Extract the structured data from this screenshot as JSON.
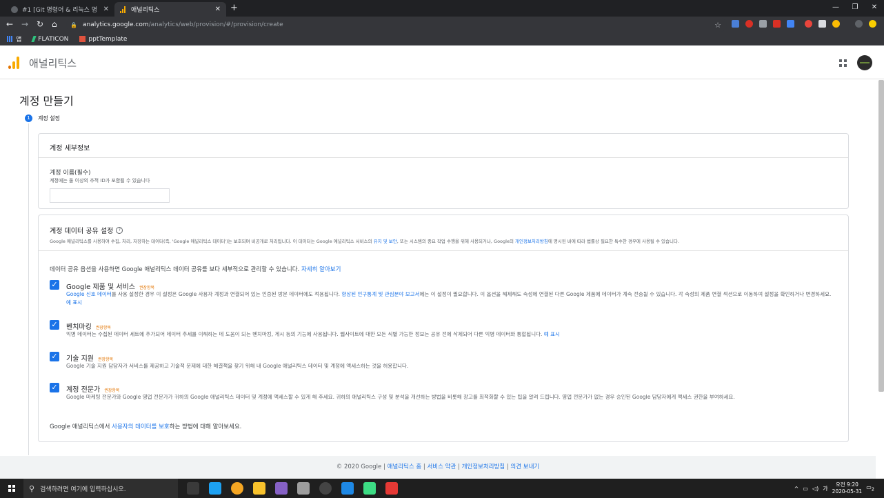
{
  "browser": {
    "tabs": [
      {
        "label": "#1 [Git 명령어 & 리눅스 명"
      },
      {
        "label": "애널리틱스"
      }
    ],
    "new_tab": "+",
    "url_domain": "analytics.google.com",
    "url_path": "/analytics/web/provision/#/provision/create",
    "bookmarks": [
      {
        "label": "앱"
      },
      {
        "label": "FLATICON"
      },
      {
        "label": "pptTemplate"
      }
    ]
  },
  "header": {
    "title": "애널리틱스"
  },
  "page": {
    "title": "계정 만들기",
    "step_number": "1",
    "step_label": "계정 설정"
  },
  "account_details": {
    "heading": "계정 세부정보",
    "name_label": "계정 이름(필수)",
    "name_help": "계정에는 둘 이상의 추적 ID가 포함될 수 있습니다",
    "name_value": ""
  },
  "data_sharing": {
    "heading": "계정 데이터 공유 설정",
    "desc_part1": "Google 애널리틱스를 사용하여 수집, 처리, 저장하는 데이터(즉, 'Google 애널리틱스 데이터')는 보호되며 비공개로 처리됩니다. 이 데이터는 Google 애널리틱스 서비스의 ",
    "desc_link1": "유지 및 보안",
    "desc_part2": ", 또는 시스템의 중요 작업 수행을 위해 사용되거나, Google의 ",
    "desc_link2": "개인정보처리방침",
    "desc_part3": "에 명시된 바에 따라 법률상 필요한 특수한 경우에 사용될 수 있습니다.",
    "intro": "데이터 공유 옵션을 사용하면 Google 애널리틱스 데이터 공유를 보다 세부적으로 관리할 수 있습니다.",
    "intro_link": "자세히 알아보기",
    "recommended": "권장항목",
    "options": [
      {
        "title": "Google 제품 및 서비스",
        "desc_link": "Google 신호 데이터",
        "desc_a": "를 사용 설정한 경우 이 설정은 Google 사용자 계정과 연결되어 있는 인증된 방문 데이터에도 적용됩니다. ",
        "desc_link2": "향상된 인구통계 및 관심분야 보고서",
        "desc_b": "에는 이 설정이 필요합니다. 이 옵션을 해제해도 속성에 연결된 다른 Google 제품에 데이터가 계속 전송될 수 있습니다. 각 속성의 제품 연결 섹션으로 이동하여 설정을 확인하거나 변경하세요.",
        "example": "예 표시"
      },
      {
        "title": "벤치마킹",
        "desc_a": "익명 데이터는 수집된 데이터 세트에 추가되어 데이터 추세를 이해하는 데 도움이 되는 벤치마킹, 게시 등의 기능에 사용됩니다. 웹사이트에 대한 모든 식별 가능한 정보는 공유 전에 삭제되어 다른 익명 데이터와 통합됩니다.",
        "example": "예 표시"
      },
      {
        "title": "기술 지원",
        "desc_a": "Google 기술 지원 담당자가 서비스를 제공하고 기술적 문제에 대한 해결책을 찾기 위해 내 Google 애널리틱스 데이터 및 계정에 액세스하는 것을 허용합니다."
      },
      {
        "title": "계정 전문가",
        "desc_a": "Google 마케팅 전문가와 Google 영업 전문가가 귀하의 Google 애널리틱스 데이터 및 계정에 액세스할 수 있게 해 주세요. 귀하의 애널리틱스 구성 및 분석을 개선하는 방법을 비롯해 광고를 최적화할 수 있는 팁을 알려 드립니다. 영업 전문가가 없는 경우 승인된 Google 담당자에게 액세스 권한을 부여하세요."
      }
    ],
    "protect_a": "Google 애널리틱스에서 ",
    "protect_link": "사용자의 데이터를 보호",
    "protect_b": "하는 방법에 대해 알아보세요."
  },
  "footer": {
    "copyright": "© 2020 Google",
    "links": [
      "애널리틱스 홈",
      "서비스 약관",
      "개인정보처리방침",
      "의견 보내기"
    ]
  },
  "taskbar": {
    "search_placeholder": "검색하려면 여기에 입력하십시오.",
    "time": "오전 9:20",
    "date": "2020-05-31",
    "notif_count": "2"
  },
  "colors": {
    "accent": "#1a73e8",
    "recommended": "#e37400",
    "ga_orange": "#f9ab00",
    "ga_dark_orange": "#e37400"
  }
}
